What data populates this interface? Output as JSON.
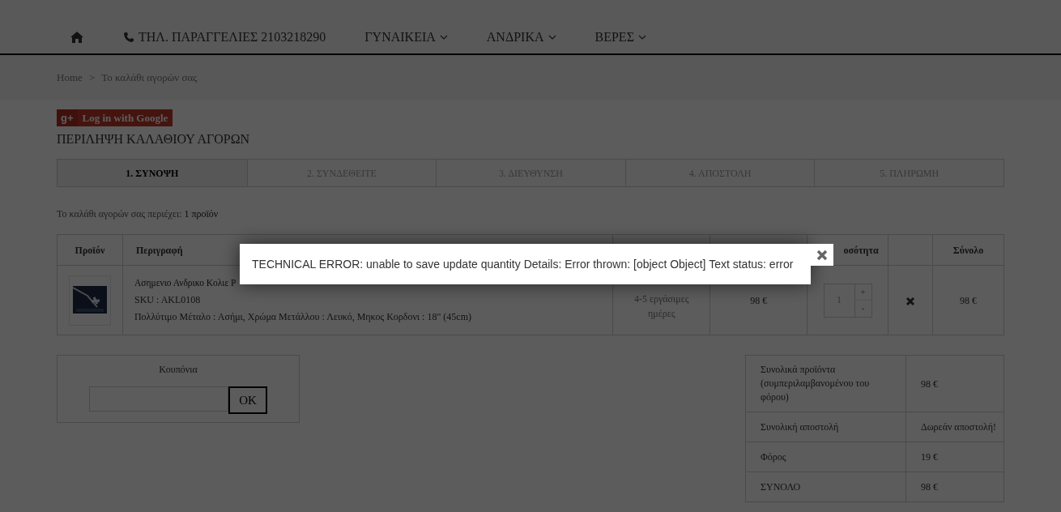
{
  "nav": {
    "items": [
      {
        "kind": "home"
      },
      {
        "kind": "phone",
        "label": "ΤΗΛ. ΠΑΡΑΓΓΕΛΙΕΣ 2103218290"
      },
      {
        "kind": "dropdown",
        "label": "ΓΥΝΑΙΚΕΙΑ"
      },
      {
        "kind": "dropdown",
        "label": "ΑΝΔΡΙΚΑ"
      },
      {
        "kind": "dropdown",
        "label": "ΒΕΡΕΣ"
      }
    ]
  },
  "breadcrumb": {
    "items": [
      "Home",
      "Το καλάθι αγορών σας"
    ],
    "separator": ">"
  },
  "google_login": {
    "icon_text": "g+",
    "label": "Log in with Google"
  },
  "page_title": "ΠΕΡΙΛΗΨΗ ΚΑΛΑΘΙΟΥ ΑΓΟΡΩΝ",
  "steps": [
    {
      "label": "1. ΣΥΝΟΨΗ",
      "selected": true
    },
    {
      "label": "2. ΣΥΝΔΕΘΕΙΤΕ",
      "selected": false
    },
    {
      "label": "3. ΔΙΕΥΘΥΝΣΗ",
      "selected": false
    },
    {
      "label": "4. ΑΠΟΣΤΟΛΗ",
      "selected": false
    },
    {
      "label": "5. ΠΛΗΡΩΜΗ",
      "selected": false
    }
  ],
  "cart_summary": {
    "text": "Το καλάθι αγορών σας περιέχει:",
    "count": "1 προϊόν"
  },
  "cart_table": {
    "columns": [
      "Προϊόν",
      "Περιγραφή",
      "",
      "",
      "οσότητα",
      "",
      "Σύνολο"
    ],
    "rows": [
      {
        "name": "Ασημενιο Ανδρικο Κολιε Ρ",
        "sku": "SKU : AKL0108",
        "attributes": "Πολλύτιμο Μέταλο : Ασήμι, Χρώμα Μετάλλου : Λευκό, Μηκος Κορδονι : 18\" (45cm)",
        "availability": "4-5 εργάσιμες ημέρες",
        "unit_price": "98 €",
        "quantity": "1",
        "increase": "+",
        "decrease": "-",
        "total": "98 €"
      }
    ]
  },
  "coupon": {
    "title": "Κουπόνια",
    "button": "OK"
  },
  "totals": [
    {
      "label": "Συνολικά προϊόντα (συμπεριλαμβανομένου του φόρου)",
      "value": "98 €"
    },
    {
      "label": "Συνολική αποστολή",
      "value": "Δωρεάν αποστολή!"
    },
    {
      "label": "Φόρος",
      "value": "19 €"
    },
    {
      "label": "ΣΥΝΟΛΟ",
      "value": "98 €"
    }
  ],
  "error_dialog": {
    "message": "TECHNICAL ERROR: unable to save update quantity Details: Error thrown: [object Object] Text status: error"
  }
}
